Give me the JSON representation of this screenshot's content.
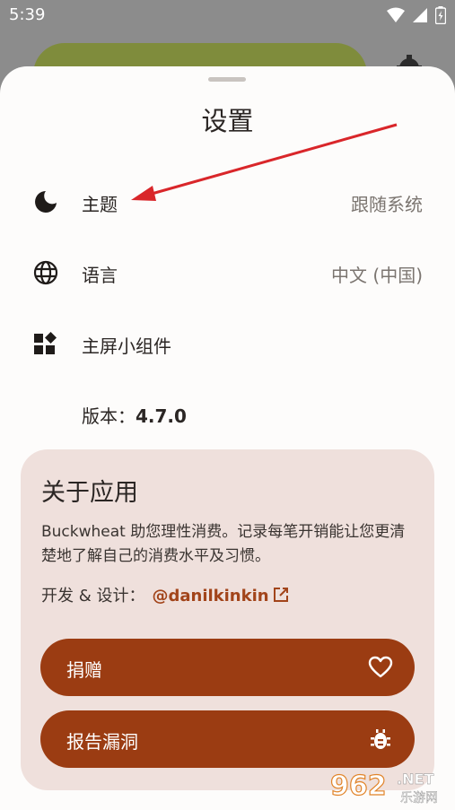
{
  "status_bar": {
    "time": "5:39"
  },
  "sheet": {
    "title": "设置"
  },
  "settings": {
    "theme": {
      "label": "主题",
      "value": "跟随系统",
      "icon": "moon-icon"
    },
    "language": {
      "label": "语言",
      "value": "中文 (中国)",
      "icon": "globe-icon"
    },
    "widget": {
      "label": "主屏小组件",
      "icon": "widgets-icon"
    },
    "version": {
      "label": "版本：",
      "value": "4.7.0"
    }
  },
  "about": {
    "title": "关于应用",
    "description": "Buckwheat 助您理性消费。记录每笔开销能让您更清楚地了解自己的消费水平及习惯。",
    "developer_label": "开发 & 设计：",
    "developer_link": "@danilkinkin"
  },
  "buttons": {
    "donate": {
      "label": "捐赠",
      "icon": "heart-icon"
    },
    "report_bug": {
      "label": "报告漏洞",
      "icon": "bug-icon"
    }
  },
  "colors": {
    "accent": "#9b3c12",
    "link": "#a2441a",
    "card_bg": "#efe0dc",
    "annotation_arrow": "#d9262a"
  },
  "watermark": {
    "number": "962",
    "suffix": ".NET",
    "cn": "乐游网"
  }
}
